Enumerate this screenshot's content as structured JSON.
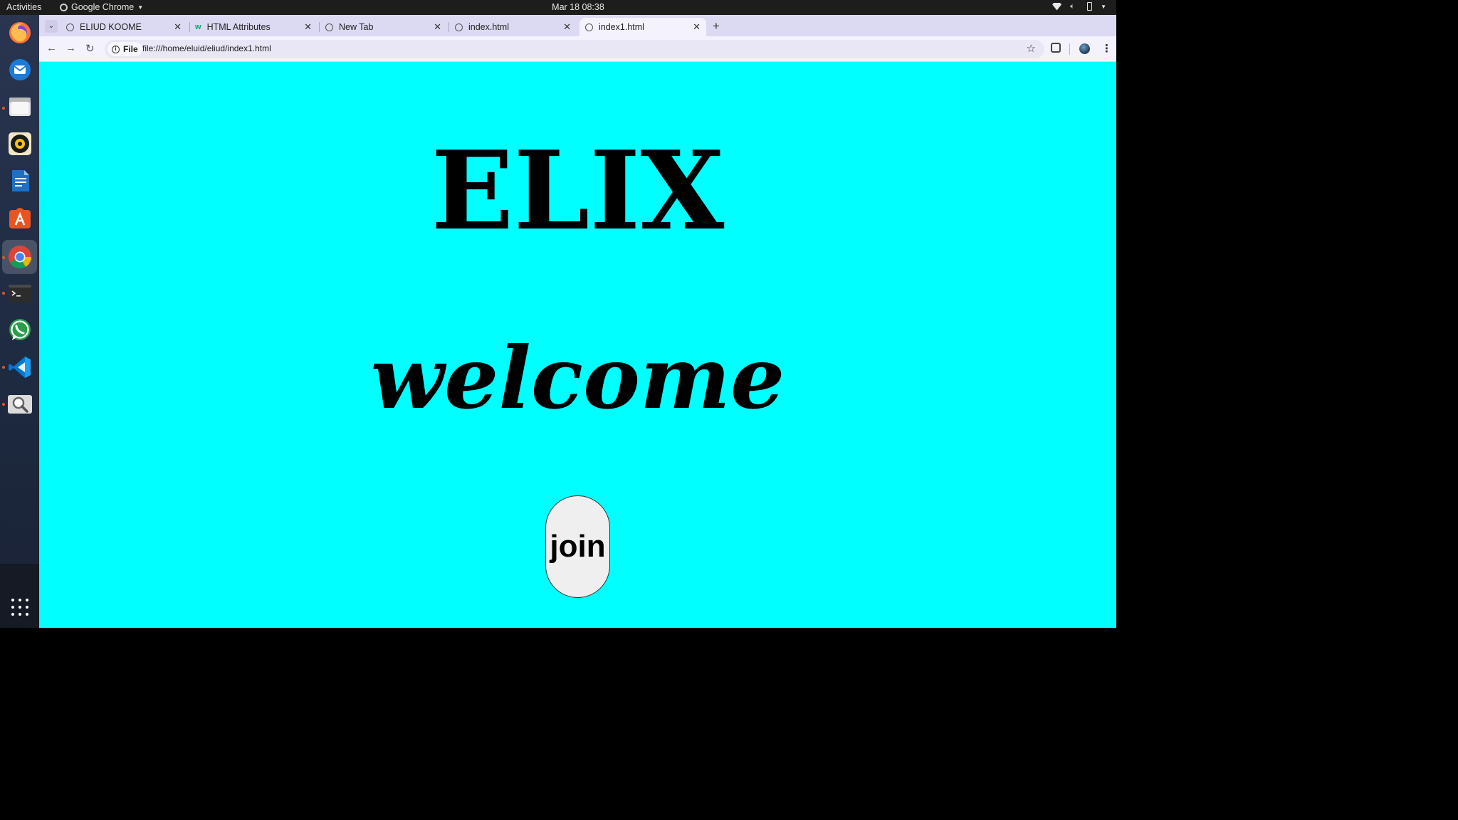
{
  "system_bar": {
    "activities": "Activities",
    "app_name": "Google Chrome",
    "clock": "Mar 18  08:38"
  },
  "dock": {
    "apps": [
      "firefox-icon",
      "thunderbird-icon",
      "files-icon",
      "rhythmbox-icon",
      "writer-icon",
      "app-center-icon",
      "chrome-icon",
      "terminal-icon",
      "whatsapp-icon",
      "vscode-icon",
      "image-viewer-icon"
    ],
    "show_apps": "show-applications-icon"
  },
  "browser": {
    "tabs": [
      {
        "label": "ELIUD KOOME"
      },
      {
        "label": "HTML Attributes"
      },
      {
        "label": "New Tab"
      },
      {
        "label": "index.html"
      },
      {
        "label": "index1.html",
        "active": true
      }
    ],
    "site_chip": "File",
    "url": "file:///home/eluid/eliud/index1.html"
  },
  "page": {
    "background": "#00ffff",
    "heading": "ELIX",
    "welcome": "welcome",
    "join_label": "join"
  }
}
